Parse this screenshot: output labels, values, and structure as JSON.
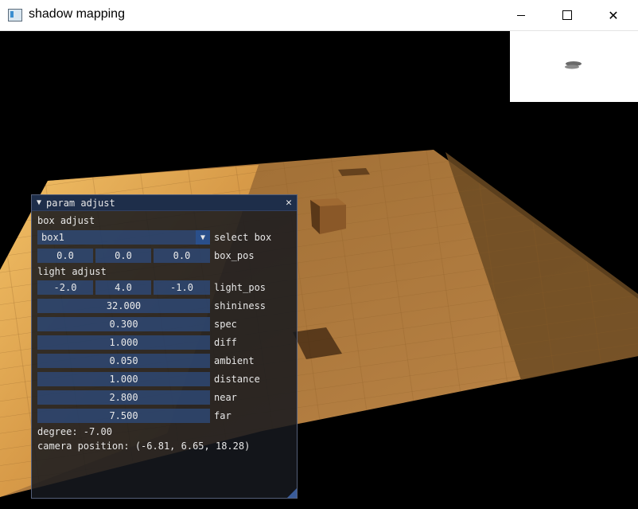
{
  "window": {
    "title": "shadow mapping",
    "minimize_label": "—",
    "maximize_label": "☐",
    "close_label": "✕"
  },
  "panel": {
    "title": "param adjust",
    "collapse_icon": "triangle-down-icon",
    "close_label": "✕",
    "box_section": "box adjust",
    "select_box": {
      "value": "box1",
      "label": "select box"
    },
    "box_pos": {
      "x": "0.0",
      "y": "0.0",
      "z": "0.0",
      "label": "box_pos"
    },
    "light_section": "light adjust",
    "light_pos": {
      "x": "-2.0",
      "y": "4.0",
      "z": "-1.0",
      "label": "light_pos"
    },
    "sliders": [
      {
        "value": "32.000",
        "label": "shininess"
      },
      {
        "value": "0.300",
        "label": "spec"
      },
      {
        "value": "1.000",
        "label": "diff"
      },
      {
        "value": "0.050",
        "label": "ambient"
      },
      {
        "value": "1.000",
        "label": "distance"
      },
      {
        "value": "2.800",
        "label": "near"
      },
      {
        "value": "7.500",
        "label": "far"
      }
    ],
    "degree": "degree: -7.00",
    "camera": "camera position: (-6.81, 6.65, 18.28)"
  },
  "colors": {
    "panel_bg": "#16181e",
    "field_bg": "#2e4a7a",
    "header_bg": "#1e2e4a",
    "floor_lit": "#d9a455",
    "floor_shadow": "#6b4a22"
  }
}
